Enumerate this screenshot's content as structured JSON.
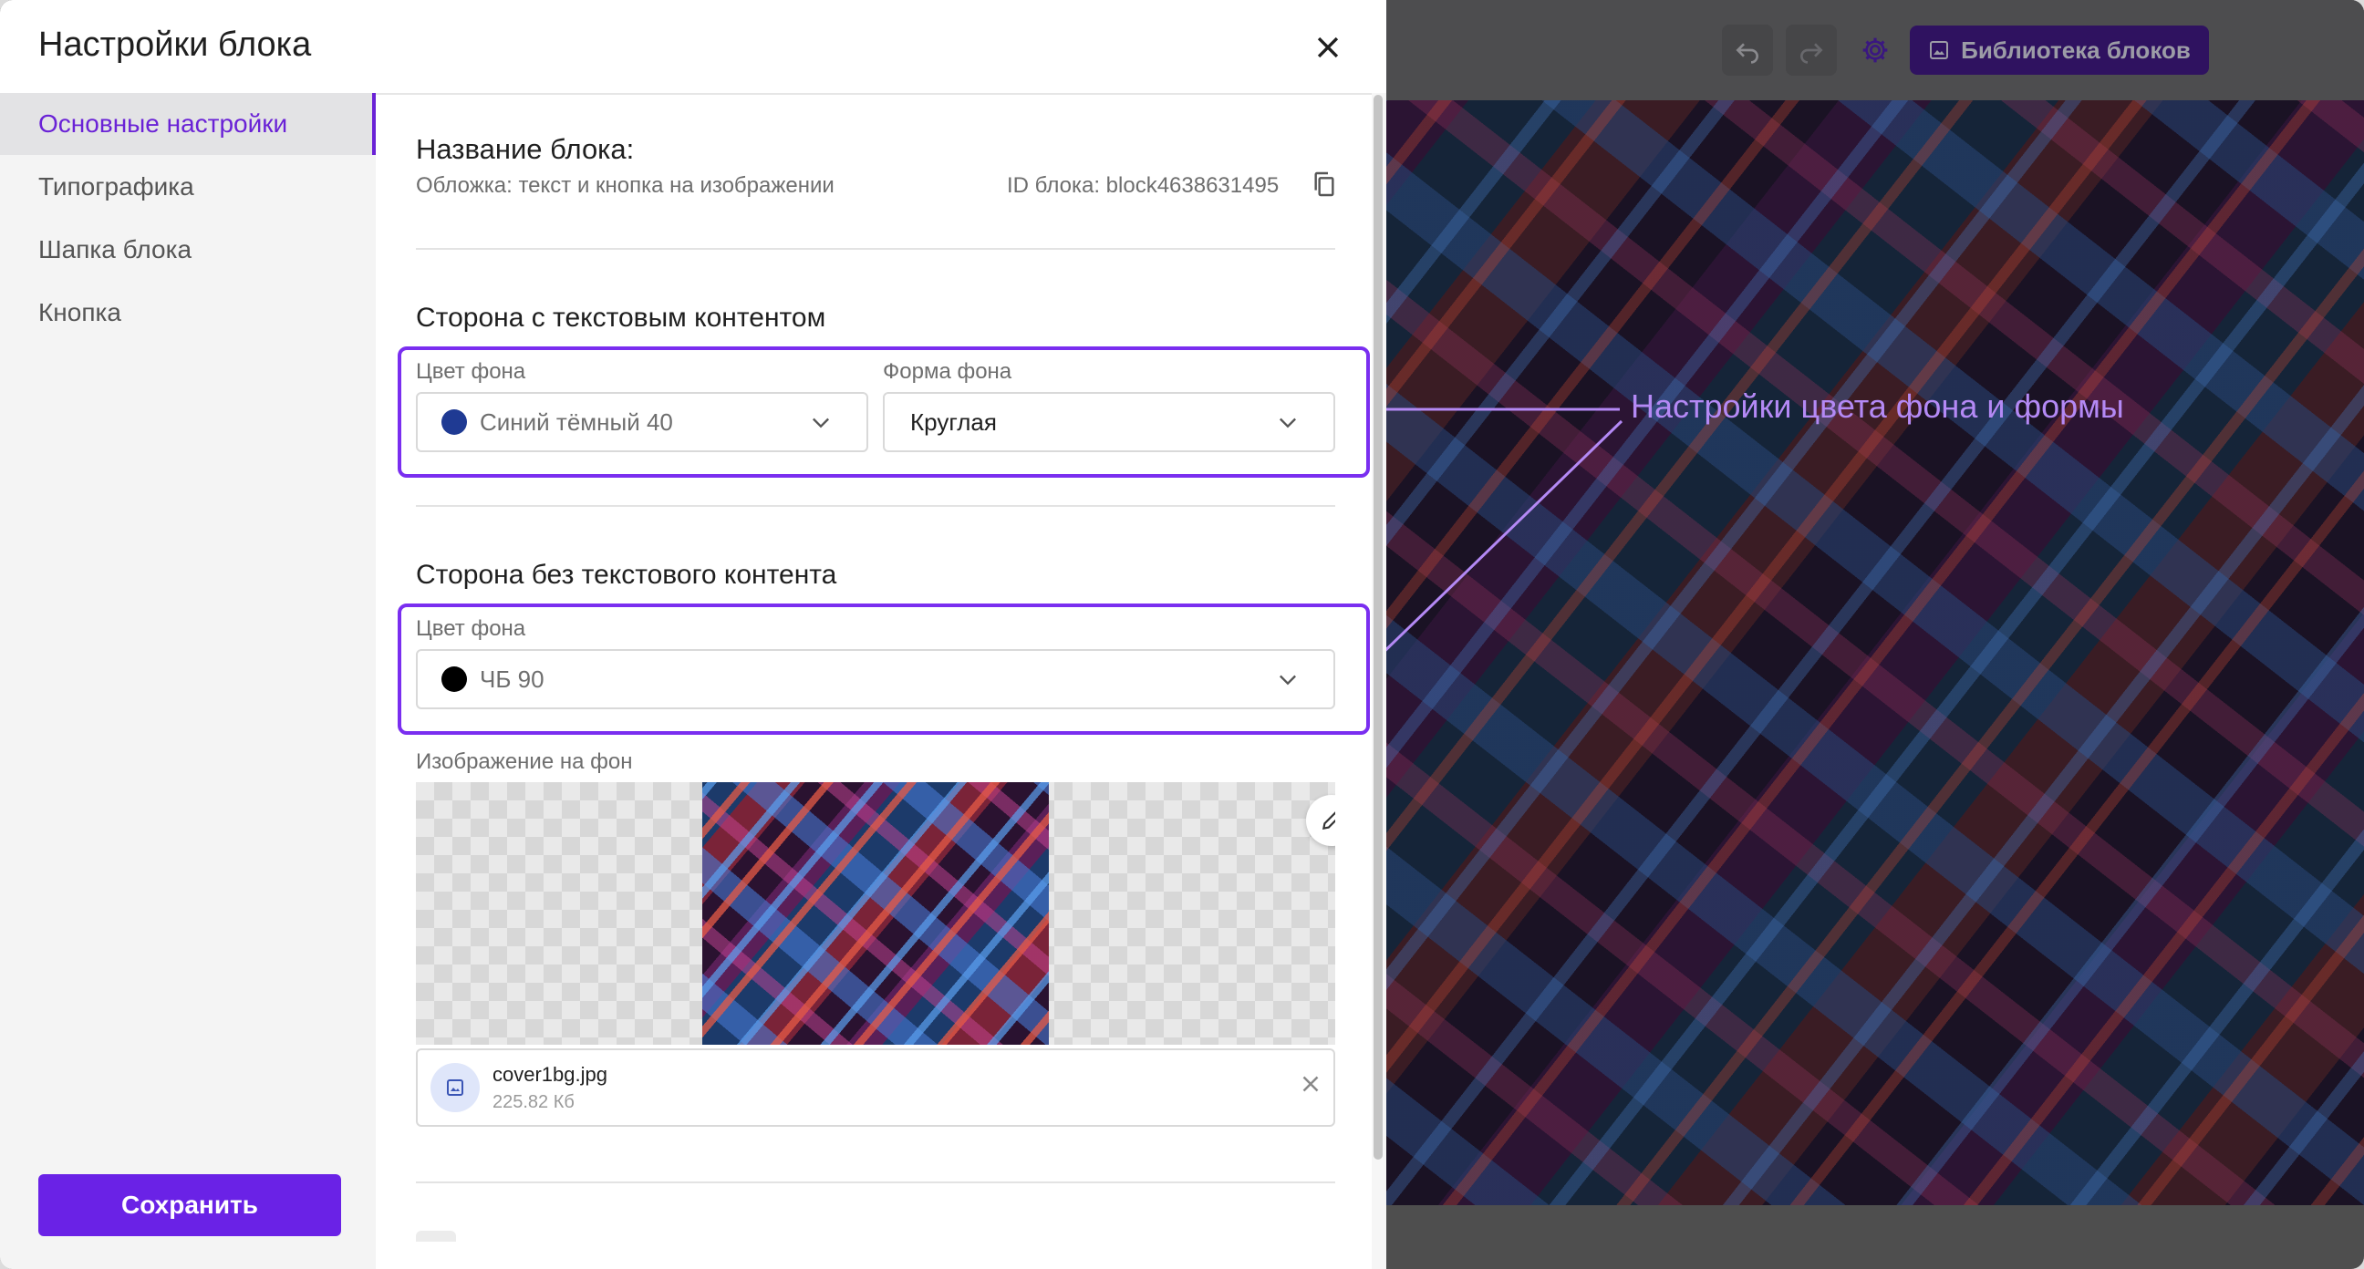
{
  "modal": {
    "title": "Настройки блока",
    "close_icon": "close-icon"
  },
  "sidebar": {
    "items": [
      {
        "label": "Основные настройки",
        "active": true
      },
      {
        "label": "Типографика",
        "active": false
      },
      {
        "label": "Шапка блока",
        "active": false
      },
      {
        "label": "Кнопка",
        "active": false
      }
    ],
    "save_label": "Сохранить"
  },
  "main": {
    "block_name_label": "Название блока:",
    "block_name_value": "Обложка: текст и кнопка на изображении",
    "block_id": "ID блока: block4638631495",
    "copy_icon": "copy-icon",
    "text_side": {
      "title": "Сторона с текстовым контентом",
      "bg_color_label": "Цвет фона",
      "bg_color_value": "Синий тёмный 40",
      "bg_color_swatch": "#1f3a93",
      "bg_shape_label": "Форма фона",
      "bg_shape_value": "Круглая"
    },
    "no_text_side": {
      "title": "Сторона без текстового контента",
      "bg_color_label": "Цвет фона",
      "bg_color_value": "ЧБ 90",
      "bg_color_swatch": "#000000"
    },
    "bg_image": {
      "label": "Изображение на фон",
      "file_name": "cover1bg.jpg",
      "file_size": "225.82 Кб",
      "edit_icon": "pencil-icon",
      "file_icon": "image-icon",
      "remove_icon": "close-icon"
    }
  },
  "editor": {
    "library_label": "Библиотека блоков",
    "undo_icon": "undo-icon",
    "redo_icon": "redo-icon",
    "settings_icon": "gear-icon"
  },
  "annotation": {
    "text": "Настройки цвета фона и формы",
    "color": "#b489f5"
  },
  "colors": {
    "accent": "#6a22e6",
    "highlight": "#7a2ef0"
  }
}
